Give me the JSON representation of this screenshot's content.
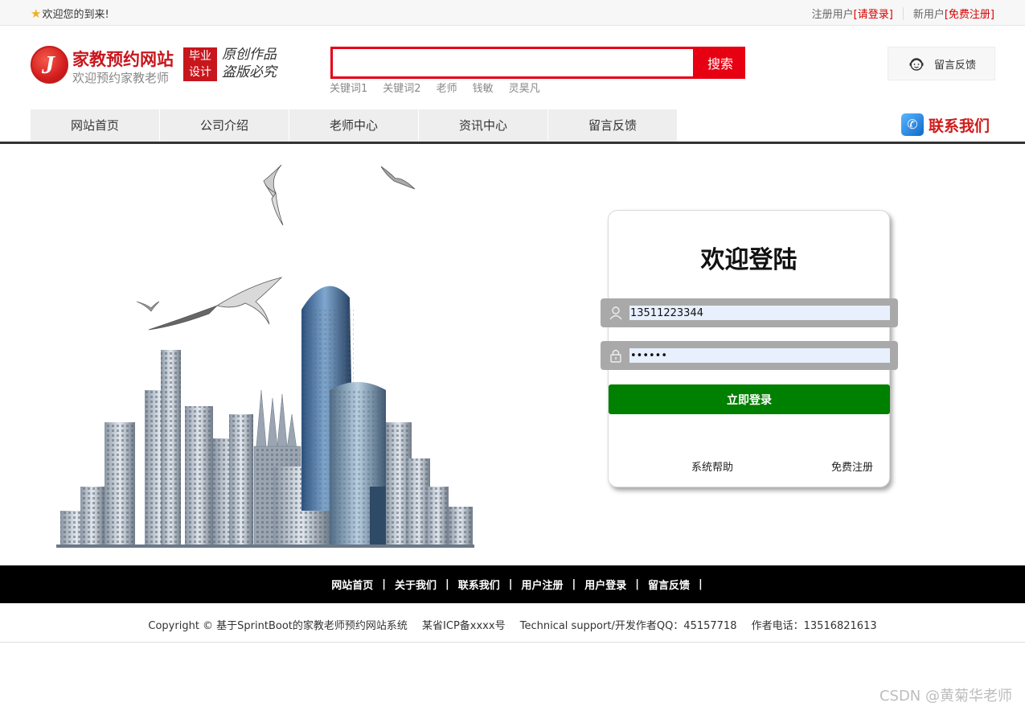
{
  "topbar": {
    "welcome": "欢迎您的到来!",
    "register_user_label": "注册用户",
    "login_link": "[请登录]",
    "new_user_label": "新用户",
    "free_register_link": "[免费注册]"
  },
  "header": {
    "site_title": "家教预约网站",
    "site_subtitle": "欢迎预约家教老师",
    "badge_line1": "毕业",
    "badge_line2": "设计",
    "slogan_line1": "原创作品",
    "slogan_line2": "盗版必究",
    "search_button": "搜索",
    "search_value": "",
    "keywords": [
      "关键词1",
      "关键词2",
      "老师",
      "钱敏",
      "灵昊凡"
    ],
    "feedback_button": "留言反馈"
  },
  "nav": {
    "items": [
      "网站首页",
      "公司介绍",
      "老师中心",
      "资讯中心",
      "留言反馈"
    ],
    "contact": "联系我们"
  },
  "login": {
    "title": "欢迎登陆",
    "username_value": "13511223344",
    "password_value": "••••••",
    "submit": "立即登录",
    "help_link": "系统帮助",
    "register_link": "免费注册"
  },
  "footer": {
    "links": [
      "网站首页",
      "关于我们",
      "联系我们",
      "用户注册",
      "用户登录",
      "留言反馈"
    ],
    "separator": "|",
    "copyright": "Copyright © 基于SprintBoot的家教老师预约网站系统",
    "icp": "某省ICP备xxxx号",
    "support": "Technical support/开发作者QQ：45157718",
    "phone": "作者电话：13516821613"
  },
  "watermark": "CSDN @黄菊华老师",
  "colors": {
    "brand_red": "#e60012",
    "login_green": "#008000",
    "footer_bg": "#000000"
  }
}
